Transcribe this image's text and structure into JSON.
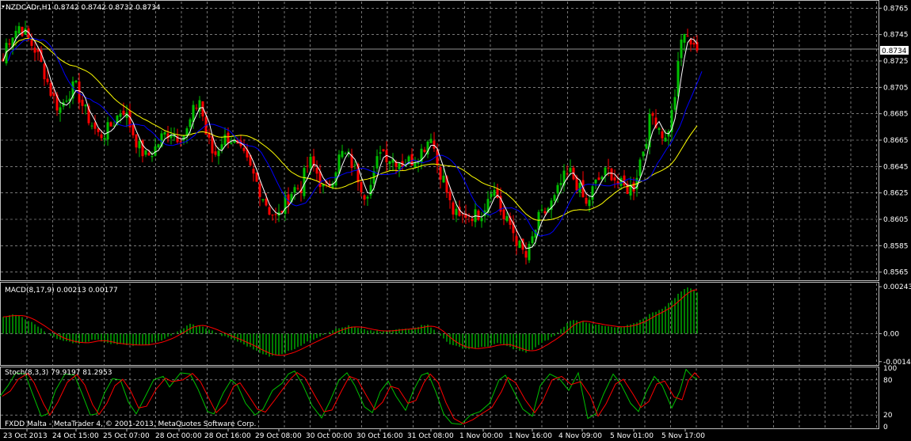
{
  "main": {
    "header": "NZDCADr,H1  0.8742 0.8742 0.8732 0.8734",
    "current_price": "0.8734",
    "price_ticks": [
      "0.8765",
      "0.8745",
      "0.8725",
      "0.8705",
      "0.8685",
      "0.8665",
      "0.8645",
      "0.8625",
      "0.8605",
      "0.8585",
      "0.8565"
    ],
    "copyright": "FXDD Malta - MetaTrader 4, © 2001-2013, MetaQuotes Software Corp."
  },
  "macd": {
    "header": "MACD(8,17,9) 0.00213 0.00177",
    "ticks": [
      "0.00243",
      "0.00",
      "-0.00145"
    ]
  },
  "stoch": {
    "header": "Stoch(8,3,3) 79.9197 81.2953",
    "ticks": [
      "100",
      "80",
      "20",
      "0"
    ]
  },
  "time_labels": [
    "23 Oct 2013",
    "24 Oct 15:00",
    "25 Oct 07:00",
    "28 Oct 00:00",
    "28 Oct 16:00",
    "29 Oct 08:00",
    "30 Oct 00:00",
    "30 Oct 16:00",
    "31 Oct 08:00",
    "1 Nov 00:00",
    "1 Nov 16:00",
    "4 Nov 09:00",
    "5 Nov 01:00",
    "5 Nov 17:00"
  ],
  "chart_data": {
    "type": "candlestick",
    "symbol": "NZDCADr",
    "timeframe": "H1",
    "ylim": [
      0.856,
      0.877
    ],
    "colors": {
      "bull": "#00c000",
      "bear": "#ff0000",
      "ma_fast": "#ffffff",
      "ma_mid": "#0000ff",
      "ma_slow": "#ffff00",
      "macd_hist": "#00c000",
      "macd_signal": "#ff0000",
      "stoch_main": "#00c000",
      "stoch_signal": "#ff0000",
      "grid": "#c0c0c0"
    },
    "close_path": [
      [
        0,
        0.8712
      ],
      [
        8,
        0.8738
      ],
      [
        15,
        0.8745
      ],
      [
        25,
        0.8752
      ],
      [
        35,
        0.8742
      ],
      [
        45,
        0.8733
      ],
      [
        55,
        0.8718
      ],
      [
        65,
        0.87
      ],
      [
        75,
        0.8688
      ],
      [
        85,
        0.87
      ],
      [
        95,
        0.8706
      ],
      [
        105,
        0.869
      ],
      [
        115,
        0.8678
      ],
      [
        125,
        0.8668
      ],
      [
        135,
        0.8672
      ],
      [
        145,
        0.868
      ],
      [
        155,
        0.869
      ],
      [
        165,
        0.8675
      ],
      [
        175,
        0.866
      ],
      [
        185,
        0.8652
      ],
      [
        195,
        0.8658
      ],
      [
        205,
        0.8668
      ],
      [
        215,
        0.8672
      ],
      [
        225,
        0.8668
      ],
      [
        235,
        0.867
      ],
      [
        245,
        0.8688
      ],
      [
        252,
        0.8696
      ],
      [
        260,
        0.867
      ],
      [
        270,
        0.8652
      ],
      [
        280,
        0.8665
      ],
      [
        290,
        0.8668
      ],
      [
        300,
        0.8658
      ],
      [
        310,
        0.865
      ],
      [
        320,
        0.8638
      ],
      [
        330,
        0.8625
      ],
      [
        340,
        0.8612
      ],
      [
        350,
        0.8605
      ],
      [
        360,
        0.8618
      ],
      [
        370,
        0.8628
      ],
      [
        380,
        0.863
      ],
      [
        390,
        0.865
      ],
      [
        400,
        0.864
      ],
      [
        410,
        0.8625
      ],
      [
        420,
        0.8638
      ],
      [
        430,
        0.8655
      ],
      [
        440,
        0.8652
      ],
      [
        450,
        0.864
      ],
      [
        460,
        0.8625
      ],
      [
        470,
        0.8632
      ],
      [
        480,
        0.866
      ],
      [
        490,
        0.8652
      ],
      [
        500,
        0.865
      ],
      [
        510,
        0.8648
      ],
      [
        520,
        0.865
      ],
      [
        530,
        0.8655
      ],
      [
        540,
        0.8665
      ],
      [
        545,
        0.8672
      ],
      [
        550,
        0.865
      ],
      [
        560,
        0.8635
      ],
      [
        570,
        0.8612
      ],
      [
        580,
        0.8605
      ],
      [
        590,
        0.861
      ],
      [
        600,
        0.8608
      ],
      [
        610,
        0.8612
      ],
      [
        620,
        0.863
      ],
      [
        628,
        0.8622
      ],
      [
        635,
        0.8605
      ],
      [
        645,
        0.86
      ],
      [
        655,
        0.8585
      ],
      [
        665,
        0.8575
      ],
      [
        672,
        0.859
      ],
      [
        680,
        0.8605
      ],
      [
        690,
        0.8612
      ],
      [
        700,
        0.862
      ],
      [
        710,
        0.8635
      ],
      [
        720,
        0.864
      ],
      [
        730,
        0.863
      ],
      [
        740,
        0.8615
      ],
      [
        750,
        0.863
      ],
      [
        760,
        0.8638
      ],
      [
        770,
        0.8642
      ],
      [
        780,
        0.8632
      ],
      [
        790,
        0.8628
      ],
      [
        800,
        0.863
      ],
      [
        808,
        0.865
      ],
      [
        815,
        0.8665
      ],
      [
        822,
        0.8685
      ],
      [
        830,
        0.8678
      ],
      [
        840,
        0.8665
      ],
      [
        850,
        0.869
      ],
      [
        856,
        0.872
      ],
      [
        862,
        0.875
      ],
      [
        868,
        0.874
      ],
      [
        874,
        0.8742
      ],
      [
        880,
        0.8734
      ]
    ],
    "macd_path": [
      [
        0,
        0.0008
      ],
      [
        20,
        0.001
      ],
      [
        40,
        0.0006
      ],
      [
        60,
        0.0
      ],
      [
        80,
        -0.0004
      ],
      [
        100,
        -0.0005
      ],
      [
        120,
        -0.0003
      ],
      [
        140,
        -0.0005
      ],
      [
        160,
        -0.0006
      ],
      [
        180,
        -0.0006
      ],
      [
        200,
        -0.0004
      ],
      [
        220,
        0.0
      ],
      [
        240,
        0.0005
      ],
      [
        260,
        0.0003
      ],
      [
        280,
        -0.0001
      ],
      [
        300,
        -0.0004
      ],
      [
        320,
        -0.0008
      ],
      [
        340,
        -0.0012
      ],
      [
        360,
        -0.001
      ],
      [
        380,
        -0.0006
      ],
      [
        400,
        -0.0002
      ],
      [
        420,
        0.0002
      ],
      [
        440,
        0.0004
      ],
      [
        460,
        0.0002
      ],
      [
        480,
        0.0001
      ],
      [
        500,
        0.0002
      ],
      [
        520,
        0.0003
      ],
      [
        540,
        0.0005
      ],
      [
        550,
        0.0001
      ],
      [
        570,
        -0.0006
      ],
      [
        590,
        -0.0008
      ],
      [
        610,
        -0.0007
      ],
      [
        630,
        -0.0005
      ],
      [
        650,
        -0.0008
      ],
      [
        665,
        -0.001
      ],
      [
        680,
        -0.0006
      ],
      [
        700,
        -0.0001
      ],
      [
        720,
        0.0007
      ],
      [
        740,
        0.0006
      ],
      [
        760,
        0.0004
      ],
      [
        780,
        0.0003
      ],
      [
        800,
        0.0005
      ],
      [
        820,
        0.001
      ],
      [
        840,
        0.0014
      ],
      [
        860,
        0.0022
      ],
      [
        870,
        0.00243
      ],
      [
        880,
        0.00213
      ]
    ],
    "stoch_points": [
      [
        0,
        52
      ],
      [
        10,
        70
      ],
      [
        20,
        92
      ],
      [
        32,
        90
      ],
      [
        40,
        60
      ],
      [
        52,
        18
      ],
      [
        60,
        22
      ],
      [
        70,
        62
      ],
      [
        82,
        90
      ],
      [
        94,
        88
      ],
      [
        104,
        55
      ],
      [
        114,
        20
      ],
      [
        122,
        22
      ],
      [
        132,
        58
      ],
      [
        142,
        82
      ],
      [
        152,
        80
      ],
      [
        162,
        42
      ],
      [
        172,
        22
      ],
      [
        182,
        48
      ],
      [
        194,
        80
      ],
      [
        206,
        86
      ],
      [
        214,
        68
      ],
      [
        228,
        92
      ],
      [
        240,
        90
      ],
      [
        250,
        64
      ],
      [
        262,
        26
      ],
      [
        270,
        22
      ],
      [
        282,
        58
      ],
      [
        292,
        80
      ],
      [
        300,
        70
      ],
      [
        310,
        40
      ],
      [
        322,
        20
      ],
      [
        332,
        30
      ],
      [
        344,
        62
      ],
      [
        356,
        74
      ],
      [
        364,
        90
      ],
      [
        372,
        95
      ],
      [
        382,
        72
      ],
      [
        394,
        36
      ],
      [
        406,
        15
      ],
      [
        416,
        42
      ],
      [
        428,
        80
      ],
      [
        438,
        92
      ],
      [
        448,
        70
      ],
      [
        460,
        34
      ],
      [
        470,
        24
      ],
      [
        480,
        60
      ],
      [
        490,
        78
      ],
      [
        500,
        52
      ],
      [
        512,
        28
      ],
      [
        522,
        62
      ],
      [
        532,
        88
      ],
      [
        540,
        92
      ],
      [
        550,
        60
      ],
      [
        560,
        22
      ],
      [
        570,
        6
      ],
      [
        582,
        4
      ],
      [
        594,
        20
      ],
      [
        606,
        26
      ],
      [
        618,
        40
      ],
      [
        630,
        80
      ],
      [
        638,
        88
      ],
      [
        648,
        62
      ],
      [
        660,
        30
      ],
      [
        672,
        18
      ],
      [
        682,
        70
      ],
      [
        694,
        90
      ],
      [
        706,
        82
      ],
      [
        718,
        62
      ],
      [
        730,
        92
      ],
      [
        742,
        14
      ],
      [
        752,
        22
      ],
      [
        762,
        56
      ],
      [
        774,
        90
      ],
      [
        784,
        72
      ],
      [
        796,
        40
      ],
      [
        806,
        26
      ],
      [
        816,
        60
      ],
      [
        826,
        86
      ],
      [
        836,
        70
      ],
      [
        848,
        32
      ],
      [
        858,
        60
      ],
      [
        866,
        98
      ],
      [
        874,
        86
      ],
      [
        880,
        81
      ]
    ]
  }
}
